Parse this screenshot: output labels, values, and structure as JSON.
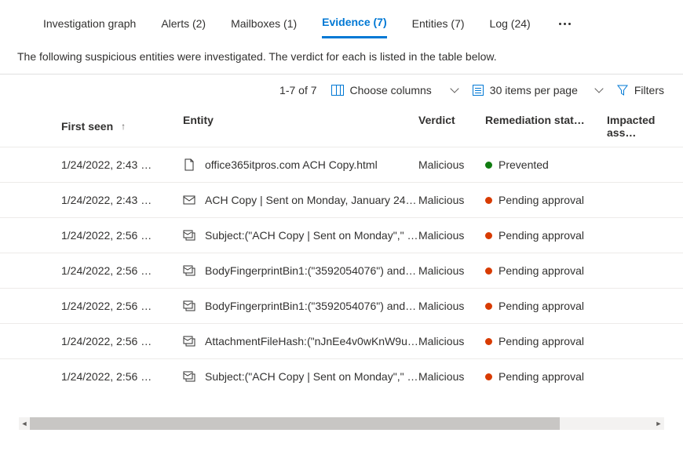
{
  "tabs": [
    {
      "label": "Investigation graph",
      "active": false
    },
    {
      "label": "Alerts  (2)",
      "active": false
    },
    {
      "label": "Mailboxes  (1)",
      "active": false
    },
    {
      "label": "Evidence  (7)",
      "active": true
    },
    {
      "label": "Entities  (7)",
      "active": false
    },
    {
      "label": "Log (24)",
      "active": false
    }
  ],
  "description": "The following suspicious entities were investigated. The verdict for each is listed in the table below.",
  "toolbar": {
    "range": "1-7 of 7",
    "choose_columns": "Choose columns",
    "items_per_page": "30 items per page",
    "filters": "Filters"
  },
  "headers": {
    "first_seen": "First seen",
    "entity": "Entity",
    "verdict": "Verdict",
    "remediation": "Remediation stat…",
    "impacted": "Impacted ass…"
  },
  "rows": [
    {
      "first_seen": "1/24/2022, 2:43 …",
      "icon": "file",
      "entity": "office365itpros.com ACH Copy.html",
      "verdict": "Malicious",
      "status_color": "green",
      "status": "Prevented"
    },
    {
      "first_seen": "1/24/2022, 2:43 …",
      "icon": "mail",
      "entity": "ACH Copy | Sent on Monday, January 24, 2…",
      "verdict": "Malicious",
      "status_color": "orange",
      "status": "Pending approval"
    },
    {
      "first_seen": "1/24/2022, 2:56 …",
      "icon": "cluster",
      "entity": "Subject:(\"ACH Copy | Sent on Monday\",\" Ja…",
      "verdict": "Malicious",
      "status_color": "orange",
      "status": "Pending approval"
    },
    {
      "first_seen": "1/24/2022, 2:56 …",
      "icon": "cluster",
      "entity": "BodyFingerprintBin1:(\"3592054076\") and P…",
      "verdict": "Malicious",
      "status_color": "orange",
      "status": "Pending approval"
    },
    {
      "first_seen": "1/24/2022, 2:56 …",
      "icon": "cluster",
      "entity": "BodyFingerprintBin1:(\"3592054076\") and S…",
      "verdict": "Malicious",
      "status_color": "orange",
      "status": "Pending approval"
    },
    {
      "first_seen": "1/24/2022, 2:56 …",
      "icon": "cluster",
      "entity": "AttachmentFileHash:(\"nJnEe4v0wKnW9uQr…",
      "verdict": "Malicious",
      "status_color": "orange",
      "status": "Pending approval"
    },
    {
      "first_seen": "1/24/2022, 2:56 …",
      "icon": "cluster",
      "entity": "Subject:(\"ACH Copy | Sent on Monday\",\" Ja…",
      "verdict": "Malicious",
      "status_color": "orange",
      "status": "Pending approval"
    }
  ]
}
